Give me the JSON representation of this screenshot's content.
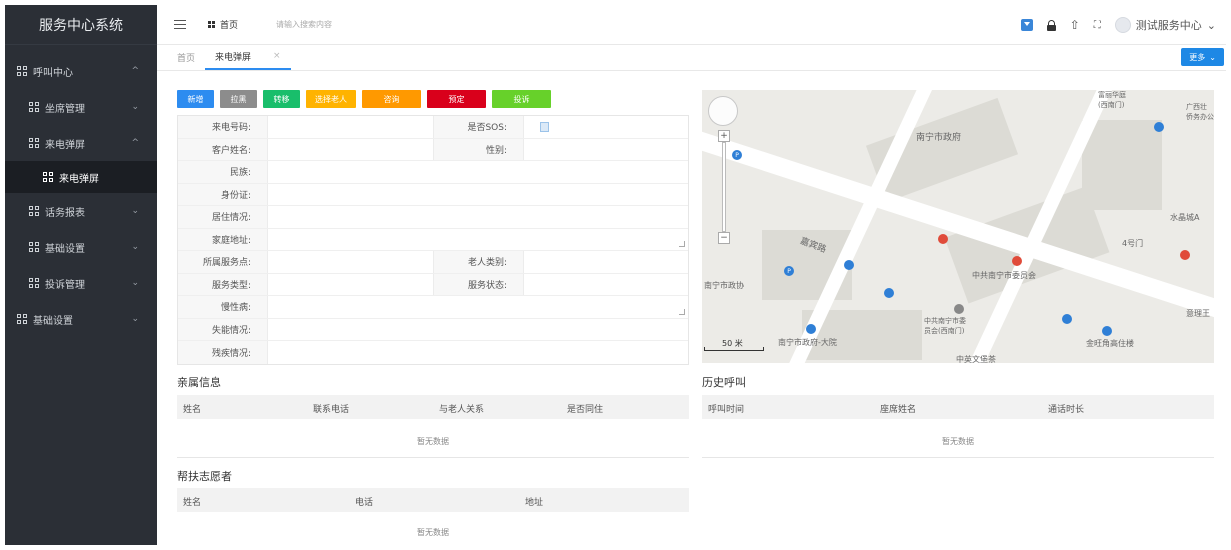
{
  "sidebar": {
    "title": "服务中心系统",
    "items": [
      {
        "label": "呼叫中心",
        "arrow": "^"
      },
      {
        "label": "坐席管理",
        "arrow": "⌄"
      },
      {
        "label": "来电弹屏",
        "arrow": "^"
      },
      {
        "label": "来电弹屏"
      },
      {
        "label": "话务报表",
        "arrow": "⌄"
      },
      {
        "label": "基础设置",
        "arrow": "⌄"
      },
      {
        "label": "投诉管理",
        "arrow": "⌄"
      },
      {
        "label": "基础设置",
        "arrow": "⌄"
      }
    ]
  },
  "header": {
    "home_label": "首页",
    "search_placeholder": "请输入搜索内容",
    "user_name": "测试服务中心",
    "user_chevron": "⌄",
    "icons": [
      "dropdown-icon",
      "lock-icon",
      "shirt-icon",
      "fullscreen-icon"
    ],
    "shirt_glyph": "⇧",
    "expand_glyph": "⛶"
  },
  "tabs": {
    "items": [
      {
        "label": "首页"
      },
      {
        "label": "来电弹屏",
        "close": "×"
      }
    ],
    "more_label": "更多",
    "more_chevron": "⌄"
  },
  "toolbar": {
    "buttons": [
      {
        "label": "新增",
        "color": "#2d8cf0"
      },
      {
        "label": "拉黑",
        "color": "#8c8c8c"
      },
      {
        "label": "转移",
        "color": "#19be6b"
      },
      {
        "label": "选择老人",
        "color": "#ffb300"
      },
      {
        "label": "咨询",
        "color": "#ff9900"
      },
      {
        "label": "预定",
        "color": "#d9001b"
      },
      {
        "label": "投诉",
        "color": "#67d12a"
      }
    ]
  },
  "form": {
    "caller_label": "来电号码:",
    "sos_label": "是否SOS:",
    "customer_label": "客户姓名:",
    "gender_label": "性别:",
    "ethnicity_label": "民族:",
    "id_label": "身份证:",
    "residence_label": "居住情况:",
    "address_label": "家庭地址:",
    "service_point_label": "所属服务点:",
    "elder_type_label": "老人类别:",
    "service_type_label": "服务类型:",
    "service_status_label": "服务状态:",
    "chronic_label": "慢性病:",
    "disability_label": "失能情况:",
    "handicap_label": "残疾情况:"
  },
  "map": {
    "labels": {
      "gov": "南宁市政府",
      "gov_left": "南宁市政协",
      "road": "嘉宾路",
      "committee": "中共南宁市委员会",
      "committee_gate": "中共南宁市委\n员会(西南门)",
      "gov_building": "南宁市政府-大院",
      "gold_tower": "金旺角高住楼",
      "crystal": "水晶城A",
      "gate4": "4号门",
      "fuli": "富丽华庭\n(西南门)",
      "guangxi": "广西壮\n侨务办公",
      "bottom": "中英文堡茶",
      "right_lbl": "意理王",
      "scale": "50 米"
    }
  },
  "relatives": {
    "title": "亲属信息",
    "columns": [
      "姓名",
      "联系电话",
      "与老人关系",
      "是否同住"
    ],
    "empty": "暂无数据"
  },
  "history": {
    "title": "历史呼叫",
    "columns": [
      "呼叫时间",
      "座席姓名",
      "通话时长"
    ],
    "empty": "暂无数据"
  },
  "volunteers": {
    "title": "帮扶志愿者",
    "columns": [
      "姓名",
      "电话",
      "地址"
    ],
    "empty": "暂无数据"
  }
}
